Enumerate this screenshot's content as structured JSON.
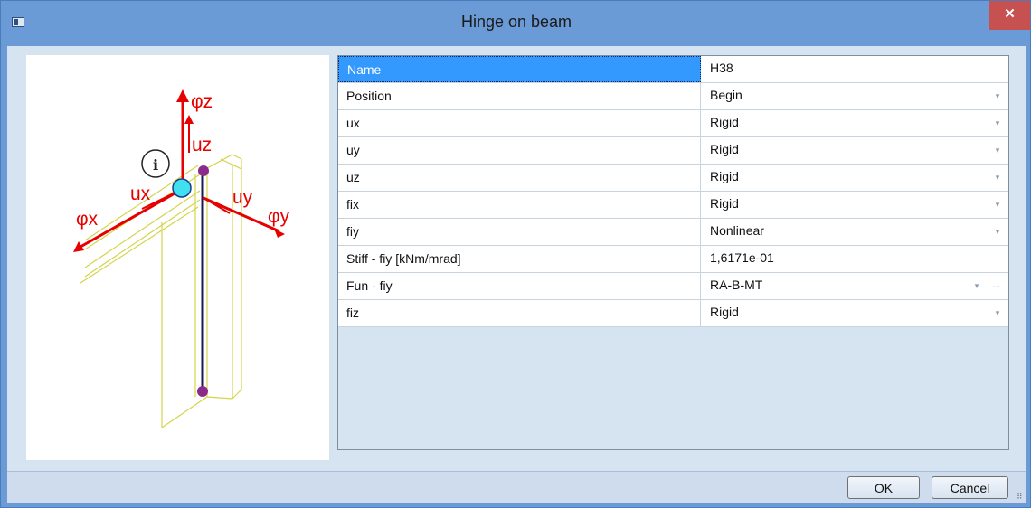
{
  "window": {
    "title": "Hinge on beam",
    "close_label": "✕"
  },
  "diagram": {
    "labels": {
      "phiz": "φz",
      "uz": "uz",
      "ux": "ux",
      "uy": "uy",
      "phix": "φx",
      "phiy": "φy",
      "info": "i"
    }
  },
  "properties": {
    "rows": [
      {
        "name": "Name",
        "value": "H38",
        "control": "text",
        "selected": true
      },
      {
        "name": "Position",
        "value": "Begin",
        "control": "dropdown"
      },
      {
        "name": "ux",
        "value": "Rigid",
        "control": "dropdown"
      },
      {
        "name": "uy",
        "value": "Rigid",
        "control": "dropdown"
      },
      {
        "name": "uz",
        "value": "Rigid",
        "control": "dropdown"
      },
      {
        "name": "fix",
        "value": "Rigid",
        "control": "dropdown"
      },
      {
        "name": "fiy",
        "value": "Nonlinear",
        "control": "dropdown"
      },
      {
        "name": "Stiff - fiy [kNm/mrad]",
        "value": "1,6171e-01",
        "control": "text"
      },
      {
        "name": "Fun - fiy",
        "value": "RA-B-MT",
        "control": "dropdown-ellipsis",
        "ellipsis_label": "..."
      },
      {
        "name": "fiz",
        "value": "Rigid",
        "control": "dropdown"
      }
    ],
    "dropdown_glyph": "▾"
  },
  "buttons": {
    "ok": "OK",
    "cancel": "Cancel"
  },
  "colors": {
    "titlebar": "#6b9bd6",
    "close": "#c75050",
    "selected_cell": "#3399ff",
    "axis_red": "#e60000",
    "beam_yellow": "#d4d44a",
    "node_cyan": "#40e0f0"
  }
}
